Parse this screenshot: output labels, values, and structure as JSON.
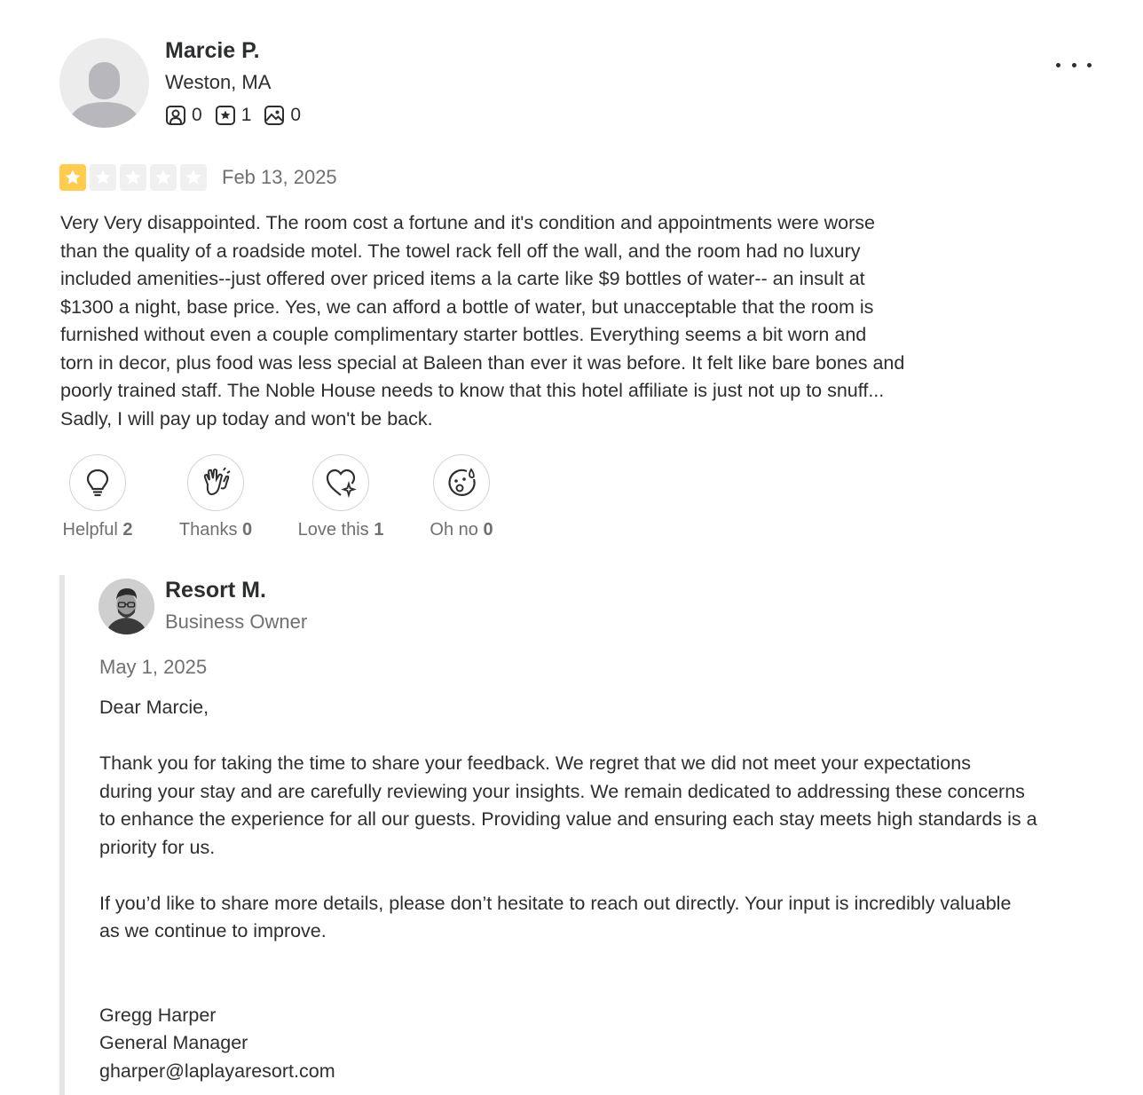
{
  "reviewer": {
    "name": "Marcie P.",
    "location": "Weston, MA",
    "stats": {
      "friends": "0",
      "reviews": "1",
      "photos": "0"
    }
  },
  "review": {
    "rating": 1,
    "max_rating": 5,
    "date": "Feb 13, 2025",
    "text": "Very Very disappointed. The room cost a fortune and it's condition and appointments were worse\nthan the quality of a roadside motel. The towel rack fell off the wall, and the room had no luxury\nincluded amenities--just offered over priced items a la carte like $9 bottles of water-- an insult at\n$1300 a night, base price. Yes, we can afford a bottle of water, but unacceptable that the room is\nfurnished without even a couple complimentary starter bottles. Everything seems a bit worn and\ntorn in decor, plus food was less special at Baleen than ever it was before. It felt like bare bones and\npoorly trained staff. The Noble House needs to know that this hotel affiliate is just not up to snuff...\nSadly, I will pay up today and won't be back."
  },
  "reactions": [
    {
      "label": "Helpful",
      "count": "2",
      "icon": "lightbulb-icon"
    },
    {
      "label": "Thanks",
      "count": "0",
      "icon": "waving-hands-icon"
    },
    {
      "label": "Love this",
      "count": "1",
      "icon": "heart-sparkle-icon"
    },
    {
      "label": "Oh no",
      "count": "0",
      "icon": "surprised-face-icon"
    }
  ],
  "owner_reply": {
    "name": "Resort M.",
    "role": "Business Owner",
    "date": "May 1, 2025",
    "text": "Dear Marcie,\n\nThank you for taking the time to share your feedback. We regret that we did not meet your expectations\nduring your stay and are carefully reviewing your insights. We remain dedicated to addressing these concerns\nto enhance the experience for all our guests. Providing value and ensuring each stay meets high standards is a\npriority for us.\n\nIf you’d like to share more details, please don’t hesitate to reach out directly. Your input is incredibly valuable\nas we continue to improve.\n\n\nGregg Harper\nGeneral Manager\ngharper@laplayaresort.com"
  },
  "colors": {
    "star_on": "#ffcc4b",
    "star_off": "#f0f0f0",
    "text": "#2d2e2f",
    "muted": "#6e7072"
  }
}
